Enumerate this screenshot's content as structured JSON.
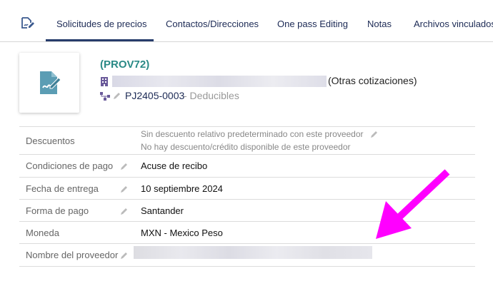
{
  "tabs": [
    {
      "label": "Solicitudes de precios",
      "active": true
    },
    {
      "label": "Contactos/Direcciones",
      "active": false
    },
    {
      "label": "One pass Editing",
      "active": false
    },
    {
      "label": "Notas",
      "active": false
    },
    {
      "label": "Archivos vinculados",
      "active": false
    }
  ],
  "header": {
    "ref": "(PROV72)",
    "company_suffix": "(Otras cotizaciones)",
    "project_code": "PJ2405-0003",
    "project_label": " - Deducibles"
  },
  "fields": {
    "discount": {
      "label": "Descuentos",
      "line1": "Sin descuento relativo predeterminado con este proveedor",
      "line2": "No hay descuento/crédito disponible de este proveedor"
    },
    "payment_terms": {
      "label": "Condiciones de pago",
      "value": "Acuse de recibo"
    },
    "delivery_date": {
      "label": "Fecha de entrega",
      "value": "10 septiembre 2024"
    },
    "payment_method": {
      "label": "Forma de pago",
      "value": "Santander"
    },
    "currency": {
      "label": "Moneda",
      "value": "MXN - Mexico Peso"
    },
    "supplier_name": {
      "label": "Nombre del proveedor"
    }
  },
  "colors": {
    "accent": "#263c6b",
    "ref_teal": "#2a8a86",
    "arrow": "#ff00ff",
    "thumb_icon": "#5b9db4"
  },
  "icons": {
    "tab": "edit-document-icon",
    "thumb": "signed-document-icon",
    "company": "building-icon",
    "project": "project-tree-icon",
    "edit": "pencil-icon"
  }
}
